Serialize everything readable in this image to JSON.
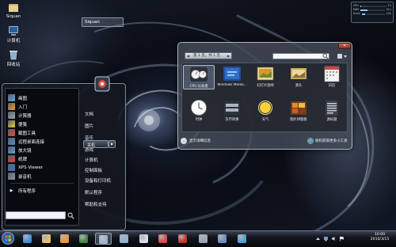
{
  "desktop": {
    "icons": [
      {
        "label": "Siquan",
        "icon": "user-folder-icon"
      },
      {
        "label": "计算机",
        "icon": "computer-icon"
      },
      {
        "label": "回收站",
        "icon": "recycle-bin-icon"
      }
    ]
  },
  "start_menu": {
    "left_items": [
      {
        "label": "画图",
        "icon": "paint-icon",
        "color": "#5fa8e8"
      },
      {
        "label": "入门",
        "icon": "getting-started-icon",
        "color": "#f0a030"
      },
      {
        "label": "计算器",
        "icon": "calculator-icon",
        "color": "#9aa6b8"
      },
      {
        "label": "便笺",
        "icon": "sticky-notes-icon",
        "color": "#e8d040"
      },
      {
        "label": "截图工具",
        "icon": "snipping-tool-icon",
        "color": "#d85040"
      },
      {
        "label": "远程桌面连接",
        "icon": "remote-desktop-icon",
        "color": "#4a90d8"
      },
      {
        "label": "放大镜",
        "icon": "magnifier-icon",
        "color": "#5aa0e0"
      },
      {
        "label": "纸牌",
        "icon": "solitaire-icon",
        "color": "#d84040"
      },
      {
        "label": "XPS Viewer",
        "icon": "xps-viewer-icon",
        "color": "#3a7ad0"
      },
      {
        "label": "录音机",
        "icon": "sound-recorder-icon",
        "color": "#8a9aaa"
      }
    ],
    "all_programs": "所有程序",
    "search_placeholder": "",
    "user_name": "Siquan",
    "right_items": [
      "文档",
      "图片",
      "音乐",
      "游戏",
      "计算机",
      "控制面板",
      "设备和打印机",
      "默认程序",
      "帮助和支持"
    ],
    "shutdown_label": "关机",
    "shutdown_arrow": "▶"
  },
  "gadget_gallery": {
    "pager_label": "第 1 页，共 1 页",
    "search_placeholder": "",
    "gadgets": [
      {
        "label": "CPU 仪表盘",
        "icon": "cpu-meter-icon",
        "selected": true
      },
      {
        "label": "Windows Media...",
        "icon": "windows-media-center-icon",
        "selected": false
      },
      {
        "label": "幻灯片放映",
        "icon": "slide-show-icon",
        "selected": false
      },
      {
        "label": "源头",
        "icon": "feed-headlines-icon",
        "selected": false
      },
      {
        "label": "日历",
        "icon": "calendar-icon",
        "selected": false
      },
      {
        "label": "时钟",
        "icon": "clock-icon",
        "selected": false
      },
      {
        "label": "货币转换",
        "icon": "currency-icon",
        "selected": false
      },
      {
        "label": "天气",
        "icon": "weather-icon",
        "selected": false
      },
      {
        "label": "图片拼图板",
        "icon": "picture-puzzle-icon",
        "selected": false
      },
      {
        "label": "源标题",
        "icon": "feed-icon",
        "selected": false
      }
    ],
    "details_label": "显示详细信息",
    "online_label": "联机获取更多小工具"
  },
  "monitor_gadget": {
    "rows": [
      {
        "label": "CPU",
        "value": "1%",
        "fill": 0.05
      },
      {
        "label": "RAM",
        "value": "31%",
        "fill": 0.31
      },
      {
        "label": "Disk",
        "value": "14%",
        "fill": 0.14
      }
    ]
  },
  "taskbar": {
    "pinned": [
      {
        "icon": "internet-explorer-icon",
        "active": false
      },
      {
        "icon": "file-explorer-icon",
        "active": false
      },
      {
        "icon": "media-player-icon",
        "active": false
      },
      {
        "icon": "media-center-icon",
        "active": false
      },
      {
        "icon": "gadget-gallery-icon",
        "active": true
      },
      {
        "icon": "window-icon",
        "active": false
      },
      {
        "icon": "notepad-icon",
        "active": false
      },
      {
        "icon": "paint-icon",
        "active": false
      },
      {
        "icon": "snipping-tool-icon",
        "active": false
      },
      {
        "icon": "settings-icon",
        "active": false
      },
      {
        "icon": "computer-icon",
        "active": false
      },
      {
        "icon": "program-icon",
        "active": false
      }
    ],
    "clock_time": "10:00",
    "clock_date": "2010/3/15"
  }
}
